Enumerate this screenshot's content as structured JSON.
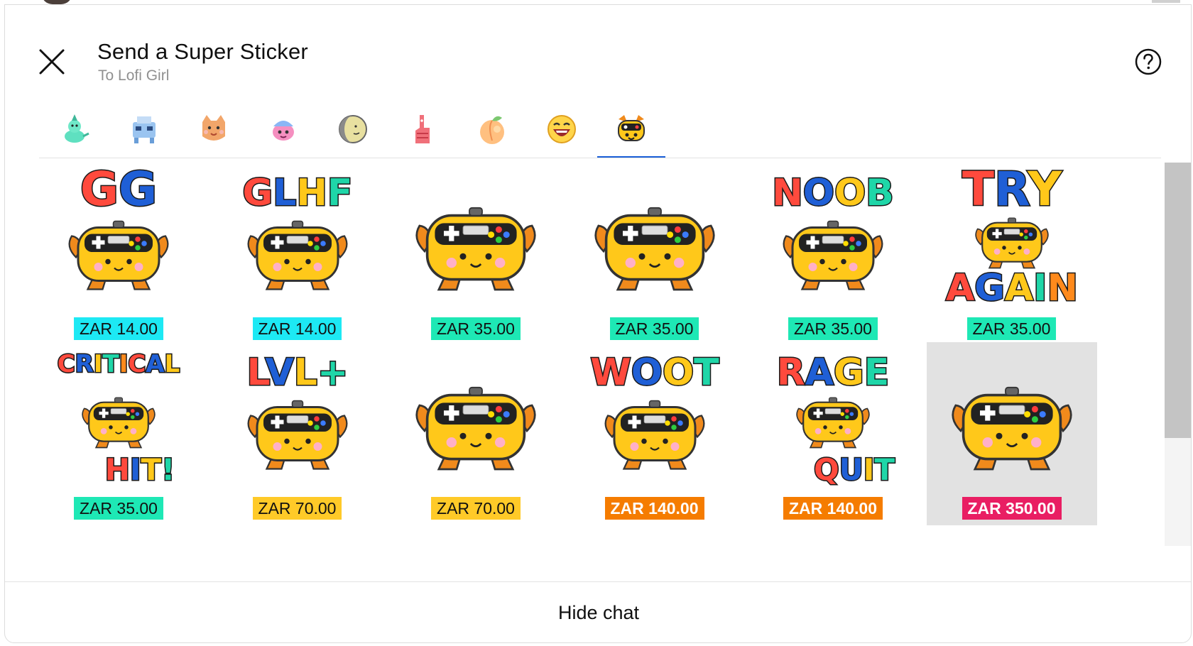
{
  "header": {
    "title": "Send a Super Sticker",
    "subtitle": "To Lofi Girl"
  },
  "footer": {
    "hide_chat_label": "Hide chat"
  },
  "colors": {
    "tab_underline": "#1a5fd8",
    "tier_blue": "#1de9f4",
    "tier_green": "#1ee8b5",
    "tier_yellow": "#ffca28",
    "tier_orange": "#f57c00",
    "tier_magenta": "#e91e63",
    "selected_bg": "#e2e2e2"
  },
  "tabs": [
    {
      "name": "tab-pack-1",
      "icon": "mint-creature-icon",
      "active": false
    },
    {
      "name": "tab-pack-2",
      "icon": "robot-creature-icon",
      "active": false
    },
    {
      "name": "tab-pack-3",
      "icon": "cat-face-icon",
      "active": false
    },
    {
      "name": "tab-pack-4",
      "icon": "pink-creature-icon",
      "active": false
    },
    {
      "name": "tab-pack-5",
      "icon": "moon-face-icon",
      "active": false
    },
    {
      "name": "tab-pack-6",
      "icon": "foam-finger-icon",
      "active": false
    },
    {
      "name": "tab-pack-7",
      "icon": "peach-icon",
      "active": false
    },
    {
      "name": "tab-pack-8",
      "icon": "laughing-face-icon",
      "active": false
    },
    {
      "name": "tab-pack-9",
      "icon": "gamepad-mascot-icon",
      "active": true
    }
  ],
  "stickers": [
    {
      "caption": "GG",
      "price": "ZAR 14.00",
      "tier": "blue"
    },
    {
      "caption": "GLHF",
      "price": "ZAR 14.00",
      "tier": "blue"
    },
    {
      "caption": "",
      "price": "ZAR 35.00",
      "tier": "green"
    },
    {
      "caption": "",
      "price": "ZAR 35.00",
      "tier": "green"
    },
    {
      "caption": "NOOB",
      "price": "ZAR 35.00",
      "tier": "green"
    },
    {
      "caption": "TRY",
      "caption2": "AGAIN",
      "price": "ZAR 35.00",
      "tier": "green"
    },
    {
      "caption": "CRITICAL",
      "caption2": "HIT!",
      "price": "ZAR 35.00",
      "tier": "green"
    },
    {
      "caption": "LVL+",
      "price": "ZAR 70.00",
      "tier": "yellow"
    },
    {
      "caption": "",
      "price": "ZAR 70.00",
      "tier": "yellow"
    },
    {
      "caption": "WOOT",
      "price": "ZAR 140.00",
      "tier": "orange"
    },
    {
      "caption": "RAGE",
      "caption2": "QUIT",
      "price": "ZAR 140.00",
      "tier": "orange"
    },
    {
      "caption": "",
      "price": "ZAR 350.00",
      "tier": "magenta",
      "selected": true
    }
  ]
}
